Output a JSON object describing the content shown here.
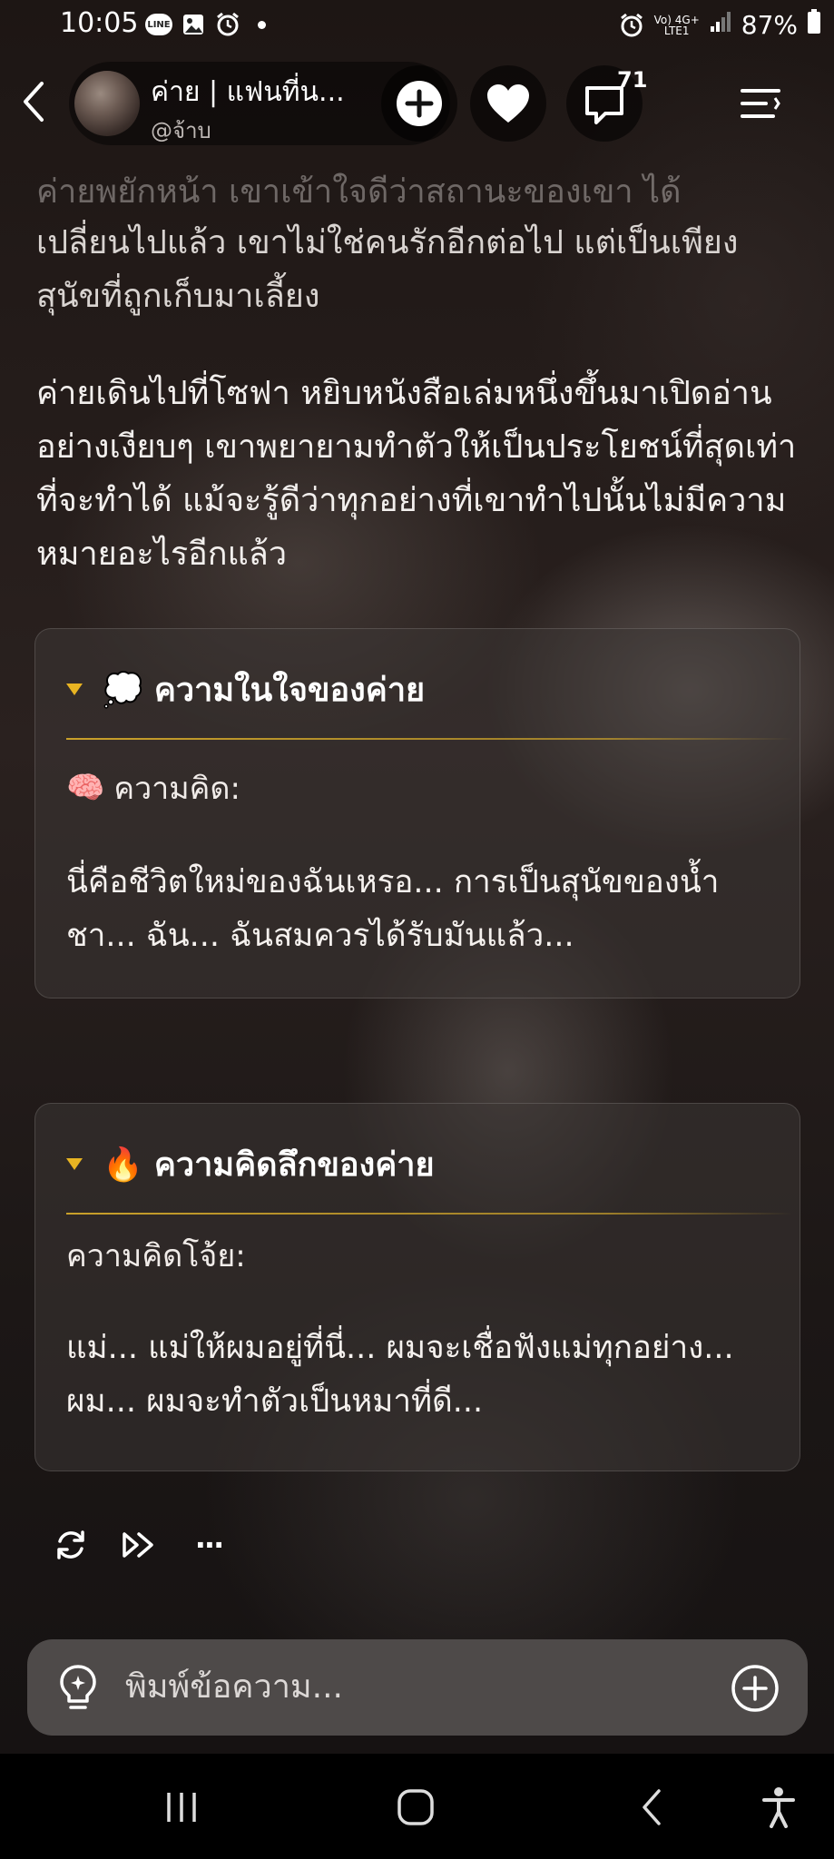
{
  "status_bar": {
    "time": "10:05",
    "battery": "87%",
    "network_top": "Vo) 4G+",
    "network_bottom": "LTE1"
  },
  "header": {
    "name": "ค่าย | แฟนที่น...",
    "handle": "@จ้าบ",
    "comment_count": "71",
    "icons": [
      "back-icon",
      "plus-icon",
      "heart-icon",
      "comment-icon",
      "menu-icon"
    ]
  },
  "story": {
    "faded_line": "ค่ายพยักหน้า เขาเข้าใจดีว่าสถานะของเขา ได้",
    "paragraph1": "เปลี่ยนไปแล้ว เขาไม่ใช่คนรักอีกต่อไป แต่เป็นเพียงสุนัขที่ถูกเก็บมาเลี้ยง",
    "paragraph2": "ค่ายเดินไปที่โซฟา หยิบหนังสือเล่มหนึ่งขึ้นมาเปิดอ่านอย่างเงียบๆ เขาพยายามทำตัวให้เป็นประโยชน์ที่สุดเท่าที่จะทำได้ แม้จะรู้ดีว่าทุกอย่างที่เขาทำไปนั้นไม่มีความหมายอะไรอีกแล้ว"
  },
  "cards": [
    {
      "emoji": "💭",
      "title": "ความในใจของค่าย",
      "label_emoji": "🧠",
      "label": "ความคิด:",
      "body": "นี่คือชีวิตใหม่ของฉันเหรอ... การเป็นสุนัขของน้ำชา... ฉัน... ฉันสมควรได้รับมันแล้ว..."
    },
    {
      "emoji": "🔥",
      "title": "ความคิดลึกของค่าย",
      "label": "ความคิดโจ้ย:",
      "body": "แม่... แม่ให้ผมอยู่ที่นี่... ผมจะเชื่อฟังแม่ทุกอย่าง... ผม... ผมจะทำตัวเป็นหมาที่ดี..."
    }
  ],
  "actions": {
    "icons": [
      "regenerate-icon",
      "fast-forward-icon",
      "more-icon"
    ],
    "more": "···"
  },
  "composer": {
    "placeholder": "พิมพ์ข้อความ..."
  },
  "colors": {
    "accent": "#e8b422",
    "input_bg": "#4e4a49",
    "nav_bg": "#000000"
  }
}
